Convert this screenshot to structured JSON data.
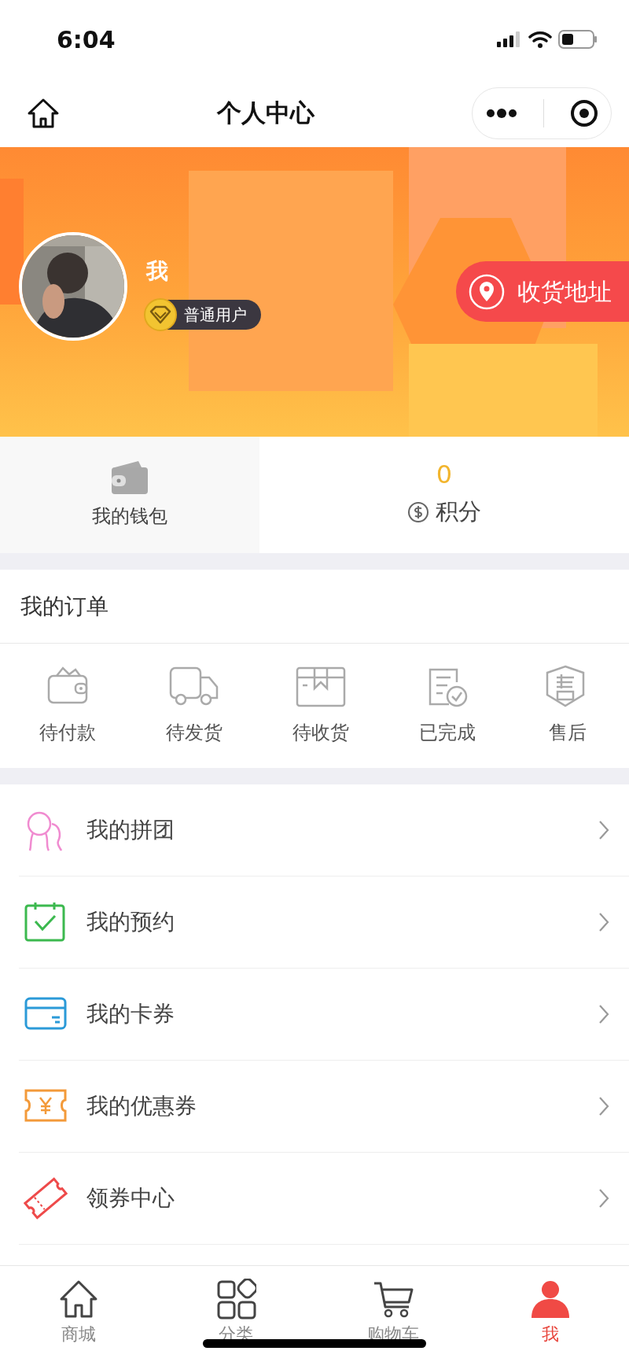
{
  "status_bar": {
    "time": "6:04"
  },
  "nav": {
    "title": "个人中心"
  },
  "profile": {
    "name": "我",
    "level": "普通用户",
    "address_button": "收货地址"
  },
  "assets": [
    {
      "kind": "wallet",
      "label": "我的钱包"
    },
    {
      "kind": "points",
      "value": "0",
      "label": "积分"
    }
  ],
  "orders": {
    "title": "我的订单",
    "items": [
      {
        "kind": "pay",
        "label": "待付款"
      },
      {
        "kind": "ship",
        "label": "待发货"
      },
      {
        "kind": "receive",
        "label": "待收货"
      },
      {
        "kind": "done",
        "label": "已完成"
      },
      {
        "kind": "aftersale",
        "label": "售后"
      }
    ]
  },
  "menu": [
    {
      "kind": "group",
      "label": "我的拼团",
      "color": "#f08bd0"
    },
    {
      "kind": "booking",
      "label": "我的预约",
      "color": "#3cb94f"
    },
    {
      "kind": "card",
      "label": "我的卡券",
      "color": "#2b9ad8"
    },
    {
      "kind": "coupon",
      "label": "我的优惠券",
      "color": "#f39a3a"
    },
    {
      "kind": "ticket",
      "label": "领券中心",
      "color": "#ee4a4a"
    }
  ],
  "tab_bar": [
    {
      "kind": "home",
      "label": "商城",
      "selected": false
    },
    {
      "kind": "category",
      "label": "分类",
      "selected": false
    },
    {
      "kind": "cart",
      "label": "购物车",
      "selected": false
    },
    {
      "kind": "me",
      "label": "我",
      "selected": true
    }
  ]
}
